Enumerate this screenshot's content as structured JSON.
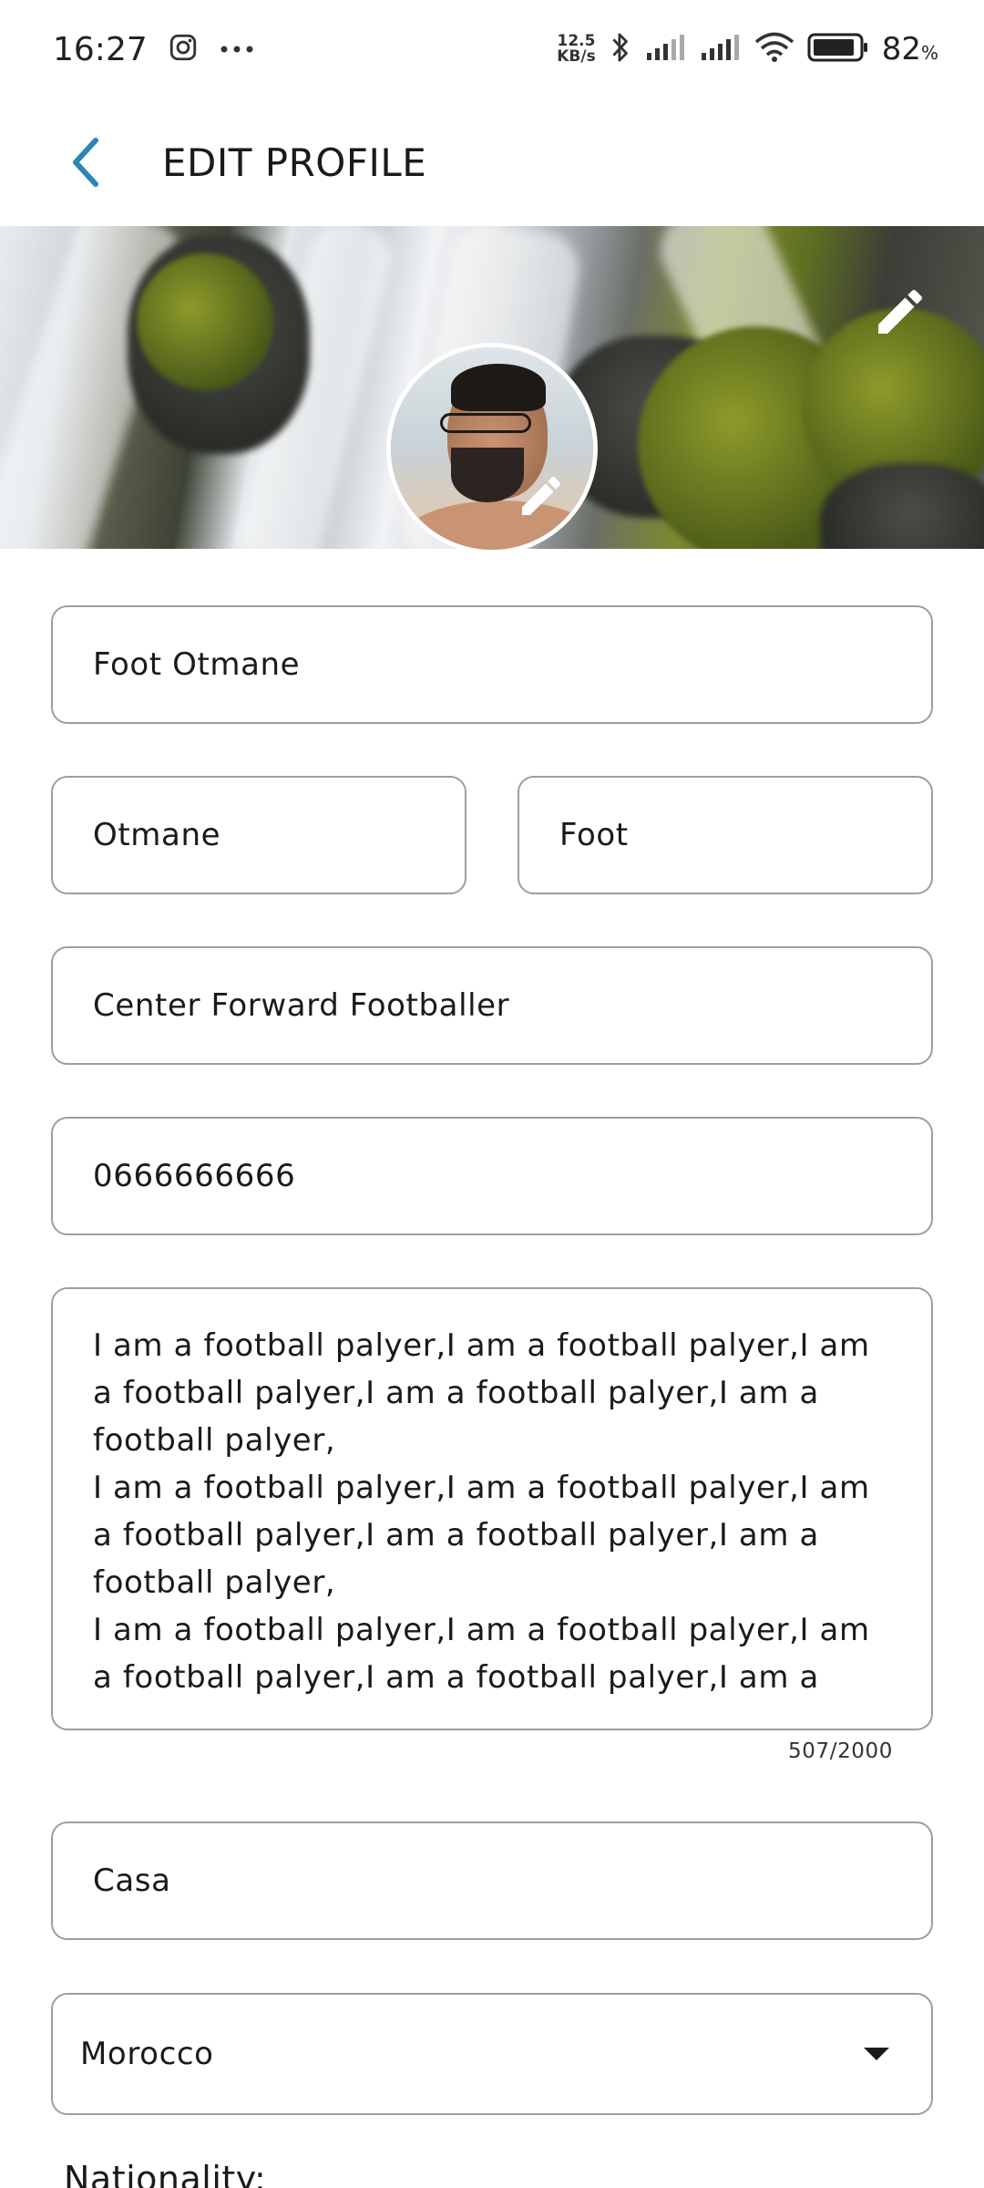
{
  "status_bar": {
    "time": "16:27",
    "net_speed_value": "12.5",
    "net_speed_unit": "KB/s",
    "battery_percent": "82",
    "battery_suffix": "%"
  },
  "app_bar": {
    "title": "EDIT PROFILE"
  },
  "form": {
    "display_name": "Foot Otmane",
    "first_name": "Otmane",
    "last_name": "Foot",
    "position": "Center Forward Footballer",
    "phone": "0666666666",
    "bio": "I am a football palyer,I am a football palyer,I am a football palyer,I am a football palyer,I am a football palyer,\nI am a football palyer,I am a football palyer,I am a football palyer,I am a football palyer,I am a football palyer,\nI am a football palyer,I am a football palyer,I am a football palyer,I am a football palyer,I am a",
    "bio_counter": "507/2000",
    "city": "Casa",
    "country_selected": "Morocco",
    "next_section_label": "Nationality:"
  },
  "colors": {
    "accent": "#2a86b3",
    "field_border": "#9e9e9e"
  }
}
